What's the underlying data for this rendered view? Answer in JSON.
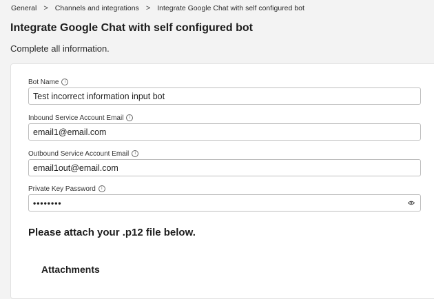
{
  "breadcrumb": {
    "items": [
      "General",
      "Channels and integrations",
      "Integrate Google Chat with self configured bot"
    ],
    "separator": ">"
  },
  "page": {
    "title": "Integrate Google Chat with self configured bot",
    "subtitle": "Complete all information."
  },
  "form": {
    "bot_name": {
      "label": "Bot Name",
      "value": "Test incorrect information input bot",
      "icon": "info-icon"
    },
    "inbound_email": {
      "label": "Inbound Service Account Email",
      "value": "email1@email.com",
      "icon": "info-icon"
    },
    "outbound_email": {
      "label": "Outbound Service Account Email",
      "value": "email1out@email.com",
      "icon": "info-icon"
    },
    "private_key_password": {
      "label": "Private Key Password",
      "value": "••••••••",
      "icon": "info-icon",
      "toggle_icon": "eye-icon"
    }
  },
  "attach": {
    "prompt": "Please attach your .p12 file below.",
    "heading": "Attachments"
  }
}
